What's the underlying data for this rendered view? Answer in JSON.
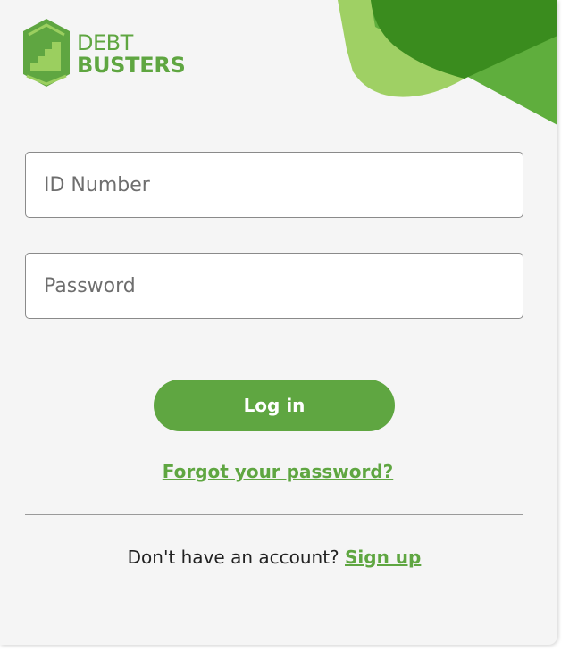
{
  "brand": {
    "line1": "DEBT",
    "line2": "BUSTERS",
    "logo_icon": "house-stairs-logo-icon",
    "color_primary": "#5fa641",
    "color_light": "#9bcf5f",
    "color_dark": "#3a8c1e"
  },
  "form": {
    "id_placeholder": "ID Number",
    "id_value": "",
    "password_placeholder": "Password",
    "password_value": "",
    "login_label": "Log in",
    "forgot_label": "Forgot your password?"
  },
  "footer": {
    "prompt": "Don't have an account?",
    "signup_label": "Sign up"
  }
}
